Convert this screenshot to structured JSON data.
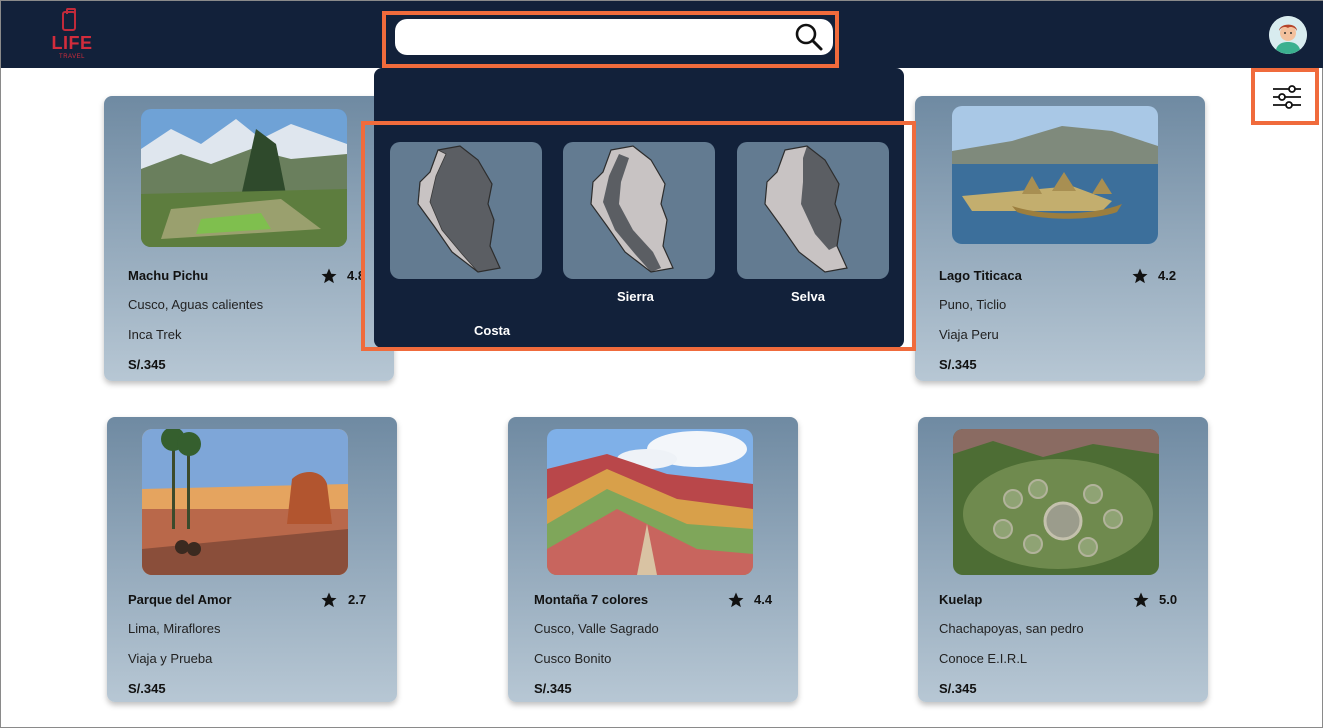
{
  "header": {
    "logo_text": "LIFE",
    "logo_subtext": "TRAVEL",
    "search": {
      "value": "",
      "placeholder": ""
    }
  },
  "regions": [
    {
      "label": "Costa"
    },
    {
      "label": "Sierra"
    },
    {
      "label": "Selva"
    }
  ],
  "cards": [
    {
      "name": "Machu Pichu",
      "rating": "4.8",
      "location": "Cusco, Aguas calientes",
      "agency": "Inca Trek",
      "price": "S/.345"
    },
    {
      "name": "Lago Titicaca",
      "rating": "4.2",
      "location": "Puno, Ticlio",
      "agency": "Viaja Peru",
      "price": "S/.345"
    },
    {
      "name": "Parque del Amor",
      "rating": "2.7",
      "location": "Lima, Miraflores",
      "agency": "Viaja y Prueba",
      "price": "S/.345"
    },
    {
      "name": "Montaña 7 colores",
      "rating": "4.4",
      "location": "Cusco, Valle Sagrado",
      "agency": "Cusco Bonito",
      "price": "S/.345"
    },
    {
      "name": "Kuelap",
      "rating": "5.0",
      "location": "Chachapoyas, san pedro",
      "agency": "Conoce E.I.R.L",
      "price": "S/.345"
    }
  ],
  "colors": {
    "header_bg": "#12213a",
    "accent_highlight": "#f06b3c",
    "logo_red": "#d22c3c",
    "card_gradient_top": "#6f8aa2",
    "card_gradient_bottom": "#b7c7d4"
  },
  "icons": [
    "search-icon",
    "user-avatar",
    "filter-sliders-icon",
    "star-icon",
    "peru-map-icon",
    "luggage-logo-icon"
  ]
}
